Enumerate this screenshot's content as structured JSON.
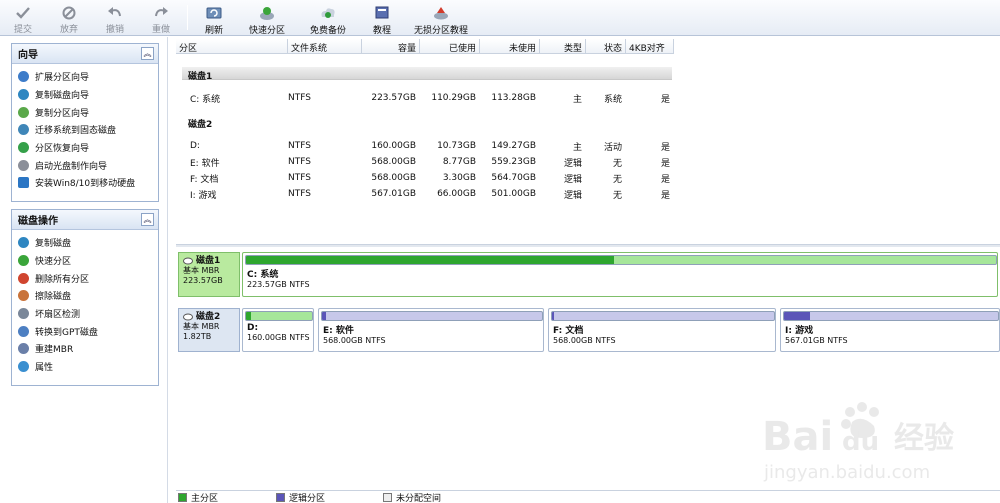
{
  "toolbar": {
    "buttons": [
      {
        "label": "提交",
        "icon": "check-icon",
        "disabled": true
      },
      {
        "label": "放弃",
        "icon": "discard-icon",
        "disabled": true
      },
      {
        "label": "撤销",
        "icon": "undo-icon",
        "disabled": true
      },
      {
        "label": "重做",
        "icon": "redo-icon",
        "disabled": true
      },
      {
        "label": "刷新",
        "icon": "refresh-icon",
        "disabled": false
      },
      {
        "label": "快速分区",
        "icon": "quick-partition-icon",
        "disabled": false
      },
      {
        "label": "免费备份",
        "icon": "backup-icon",
        "disabled": false
      },
      {
        "label": "教程",
        "icon": "tutorial-icon",
        "disabled": false
      },
      {
        "label": "无损分区教程",
        "icon": "lossless-tutorial-icon",
        "disabled": false
      }
    ]
  },
  "wizard_panel": {
    "title": "向导",
    "items": [
      "扩展分区向导",
      "复制磁盘向导",
      "复制分区向导",
      "迁移系统到固态磁盘",
      "分区恢复向导",
      "启动光盘制作向导",
      "安装Win8/10到移动硬盘"
    ]
  },
  "disk_ops_panel": {
    "title": "磁盘操作",
    "items": [
      "复制磁盘",
      "快速分区",
      "删除所有分区",
      "擦除磁盘",
      "坏扇区检测",
      "转换到GPT磁盘",
      "重建MBR",
      "属性"
    ]
  },
  "table": {
    "headers": [
      "分区",
      "文件系统",
      "容量",
      "已使用",
      "未使用",
      "类型",
      "状态",
      "4KB对齐"
    ],
    "groups": [
      {
        "disk": "磁盘1",
        "rows": [
          [
            "C: 系统",
            "NTFS",
            "223.57GB",
            "110.29GB",
            "113.28GB",
            "主",
            "系统",
            "是"
          ]
        ]
      },
      {
        "disk": "磁盘2",
        "rows": [
          [
            "D:",
            "NTFS",
            "160.00GB",
            "10.73GB",
            "149.27GB",
            "主",
            "活动",
            "是"
          ],
          [
            "E: 软件",
            "NTFS",
            "568.00GB",
            "8.77GB",
            "559.23GB",
            "逻辑",
            "无",
            "是"
          ],
          [
            "F: 文档",
            "NTFS",
            "568.00GB",
            "3.30GB",
            "564.70GB",
            "逻辑",
            "无",
            "是"
          ],
          [
            "I: 游戏",
            "NTFS",
            "567.01GB",
            "66.00GB",
            "501.00GB",
            "逻辑",
            "无",
            "是"
          ]
        ]
      }
    ]
  },
  "disk_map": {
    "disk1": {
      "name": "磁盘1",
      "type": "基本 MBR",
      "size": "223.57GB",
      "partitions": [
        {
          "name": "C: 系统",
          "info": "223.57GB NTFS",
          "used_fraction": 0.49
        }
      ]
    },
    "disk2": {
      "name": "磁盘2",
      "type": "基本 MBR",
      "size": "1.82TB",
      "partitions": [
        {
          "name": "D:",
          "info": "160.00GB NTFS",
          "used_fraction": 0.07
        },
        {
          "name": "E: 软件",
          "info": "568.00GB NTFS",
          "used_fraction": 0.02
        },
        {
          "name": "F: 文档",
          "info": "568.00GB NTFS",
          "used_fraction": 0.01
        },
        {
          "name": "I: 游戏",
          "info": "567.01GB NTFS",
          "used_fraction": 0.12
        }
      ]
    }
  },
  "legend": {
    "primary": "主分区",
    "logical": "逻辑分区",
    "unallocated": "未分配空间"
  },
  "colors": {
    "primary": "#2ea62e",
    "primary_light": "#a6e69a",
    "logical": "#5b55b8",
    "logical_light": "#c7c8ea",
    "unallocated": "#eeeeee"
  },
  "watermark": {
    "logo": "Baidu 经验",
    "url": "jingyan.baidu.com"
  }
}
